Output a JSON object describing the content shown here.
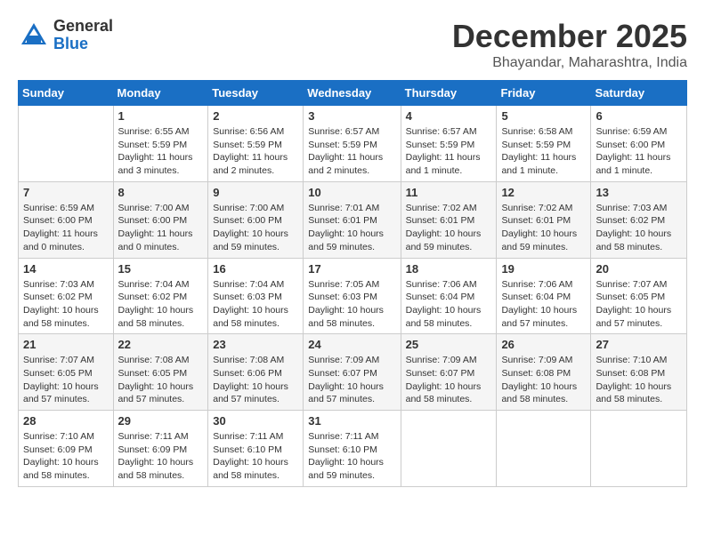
{
  "header": {
    "logo": {
      "general": "General",
      "blue": "Blue"
    },
    "title": "December 2025",
    "location": "Bhayandar, Maharashtra, India"
  },
  "calendar": {
    "columns": [
      "Sunday",
      "Monday",
      "Tuesday",
      "Wednesday",
      "Thursday",
      "Friday",
      "Saturday"
    ],
    "weeks": [
      [
        {
          "day": "",
          "info": ""
        },
        {
          "day": "1",
          "info": "Sunrise: 6:55 AM\nSunset: 5:59 PM\nDaylight: 11 hours\nand 3 minutes."
        },
        {
          "day": "2",
          "info": "Sunrise: 6:56 AM\nSunset: 5:59 PM\nDaylight: 11 hours\nand 2 minutes."
        },
        {
          "day": "3",
          "info": "Sunrise: 6:57 AM\nSunset: 5:59 PM\nDaylight: 11 hours\nand 2 minutes."
        },
        {
          "day": "4",
          "info": "Sunrise: 6:57 AM\nSunset: 5:59 PM\nDaylight: 11 hours\nand 1 minute."
        },
        {
          "day": "5",
          "info": "Sunrise: 6:58 AM\nSunset: 5:59 PM\nDaylight: 11 hours\nand 1 minute."
        },
        {
          "day": "6",
          "info": "Sunrise: 6:59 AM\nSunset: 6:00 PM\nDaylight: 11 hours\nand 1 minute."
        }
      ],
      [
        {
          "day": "7",
          "info": "Sunrise: 6:59 AM\nSunset: 6:00 PM\nDaylight: 11 hours\nand 0 minutes."
        },
        {
          "day": "8",
          "info": "Sunrise: 7:00 AM\nSunset: 6:00 PM\nDaylight: 11 hours\nand 0 minutes."
        },
        {
          "day": "9",
          "info": "Sunrise: 7:00 AM\nSunset: 6:00 PM\nDaylight: 10 hours\nand 59 minutes."
        },
        {
          "day": "10",
          "info": "Sunrise: 7:01 AM\nSunset: 6:01 PM\nDaylight: 10 hours\nand 59 minutes."
        },
        {
          "day": "11",
          "info": "Sunrise: 7:02 AM\nSunset: 6:01 PM\nDaylight: 10 hours\nand 59 minutes."
        },
        {
          "day": "12",
          "info": "Sunrise: 7:02 AM\nSunset: 6:01 PM\nDaylight: 10 hours\nand 59 minutes."
        },
        {
          "day": "13",
          "info": "Sunrise: 7:03 AM\nSunset: 6:02 PM\nDaylight: 10 hours\nand 58 minutes."
        }
      ],
      [
        {
          "day": "14",
          "info": "Sunrise: 7:03 AM\nSunset: 6:02 PM\nDaylight: 10 hours\nand 58 minutes."
        },
        {
          "day": "15",
          "info": "Sunrise: 7:04 AM\nSunset: 6:02 PM\nDaylight: 10 hours\nand 58 minutes."
        },
        {
          "day": "16",
          "info": "Sunrise: 7:04 AM\nSunset: 6:03 PM\nDaylight: 10 hours\nand 58 minutes."
        },
        {
          "day": "17",
          "info": "Sunrise: 7:05 AM\nSunset: 6:03 PM\nDaylight: 10 hours\nand 58 minutes."
        },
        {
          "day": "18",
          "info": "Sunrise: 7:06 AM\nSunset: 6:04 PM\nDaylight: 10 hours\nand 58 minutes."
        },
        {
          "day": "19",
          "info": "Sunrise: 7:06 AM\nSunset: 6:04 PM\nDaylight: 10 hours\nand 57 minutes."
        },
        {
          "day": "20",
          "info": "Sunrise: 7:07 AM\nSunset: 6:05 PM\nDaylight: 10 hours\nand 57 minutes."
        }
      ],
      [
        {
          "day": "21",
          "info": "Sunrise: 7:07 AM\nSunset: 6:05 PM\nDaylight: 10 hours\nand 57 minutes."
        },
        {
          "day": "22",
          "info": "Sunrise: 7:08 AM\nSunset: 6:05 PM\nDaylight: 10 hours\nand 57 minutes."
        },
        {
          "day": "23",
          "info": "Sunrise: 7:08 AM\nSunset: 6:06 PM\nDaylight: 10 hours\nand 57 minutes."
        },
        {
          "day": "24",
          "info": "Sunrise: 7:09 AM\nSunset: 6:07 PM\nDaylight: 10 hours\nand 57 minutes."
        },
        {
          "day": "25",
          "info": "Sunrise: 7:09 AM\nSunset: 6:07 PM\nDaylight: 10 hours\nand 58 minutes."
        },
        {
          "day": "26",
          "info": "Sunrise: 7:09 AM\nSunset: 6:08 PM\nDaylight: 10 hours\nand 58 minutes."
        },
        {
          "day": "27",
          "info": "Sunrise: 7:10 AM\nSunset: 6:08 PM\nDaylight: 10 hours\nand 58 minutes."
        }
      ],
      [
        {
          "day": "28",
          "info": "Sunrise: 7:10 AM\nSunset: 6:09 PM\nDaylight: 10 hours\nand 58 minutes."
        },
        {
          "day": "29",
          "info": "Sunrise: 7:11 AM\nSunset: 6:09 PM\nDaylight: 10 hours\nand 58 minutes."
        },
        {
          "day": "30",
          "info": "Sunrise: 7:11 AM\nSunset: 6:10 PM\nDaylight: 10 hours\nand 58 minutes."
        },
        {
          "day": "31",
          "info": "Sunrise: 7:11 AM\nSunset: 6:10 PM\nDaylight: 10 hours\nand 59 minutes."
        },
        {
          "day": "",
          "info": ""
        },
        {
          "day": "",
          "info": ""
        },
        {
          "day": "",
          "info": ""
        }
      ]
    ]
  }
}
